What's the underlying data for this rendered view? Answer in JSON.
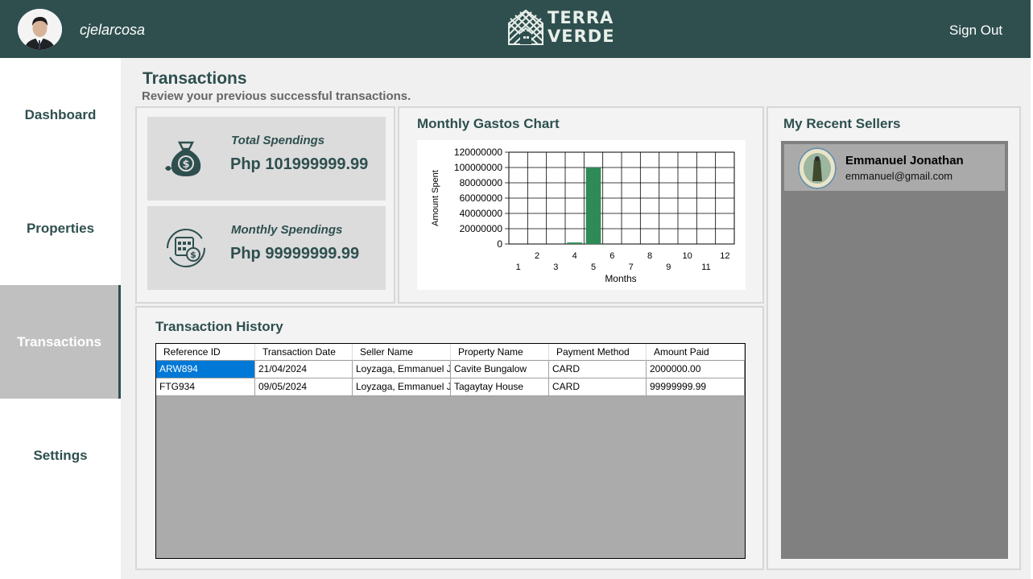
{
  "header": {
    "username": "cjelarcosa",
    "brand_line1": "TERRA",
    "brand_line2": "VERDE",
    "sign_out": "Sign Out"
  },
  "sidebar": {
    "items": [
      {
        "label": "Dashboard",
        "active": false
      },
      {
        "label": "Properties",
        "active": false
      },
      {
        "label": "Transactions",
        "active": true
      },
      {
        "label": "Settings",
        "active": false
      }
    ]
  },
  "page": {
    "title": "Transactions",
    "subtitle": "Review your previous successful transactions."
  },
  "summary": {
    "total_label": "Total Spendings",
    "total_value": "Php 101999999.99",
    "monthly_label": "Monthly Spendings",
    "monthly_value": "Php 99999999.99",
    "icons": [
      "money-bag-icon",
      "calendar-money-icon"
    ]
  },
  "chart_title": "Monthly Gastos Chart",
  "chart_data": {
    "type": "bar",
    "categories": [
      "1",
      "2",
      "3",
      "4",
      "5",
      "6",
      "7",
      "8",
      "9",
      "10",
      "11",
      "12"
    ],
    "values": [
      0,
      0,
      0,
      2000000,
      99999999.99,
      0,
      0,
      0,
      0,
      0,
      0,
      0
    ],
    "title": "",
    "xlabel": "Months",
    "ylabel": "Amount Spent",
    "ylim": [
      0,
      120000000
    ],
    "yticks": [
      "0",
      "20000000",
      "40000000",
      "60000000",
      "80000000",
      "100000000",
      "120000000"
    ],
    "grid": true,
    "bar_color": "#2e8b57"
  },
  "history": {
    "title": "Transaction History",
    "columns": [
      "Reference ID",
      "Transaction Date",
      "Seller Name",
      "Property Name",
      "Payment Method",
      "Amount Paid"
    ],
    "rows": [
      [
        "ARW894",
        "21/04/2024",
        "Loyzaga, Emmanuel J...",
        "Cavite Bungalow",
        "CARD",
        "2000000.00"
      ],
      [
        "FTG934",
        "09/05/2024",
        "Loyzaga, Emmanuel J...",
        "Tagaytay House",
        "CARD",
        "99999999.99"
      ]
    ],
    "selected_cell": "ARW894"
  },
  "sellers": {
    "title": "My Recent Sellers",
    "items": [
      {
        "name": "Emmanuel Jonathan",
        "email": "emmanuel@gmail.com"
      }
    ]
  },
  "colors": {
    "header_bg": "#2f4f4f",
    "accent": "#2f4f4f",
    "selection": "#0078d7"
  }
}
